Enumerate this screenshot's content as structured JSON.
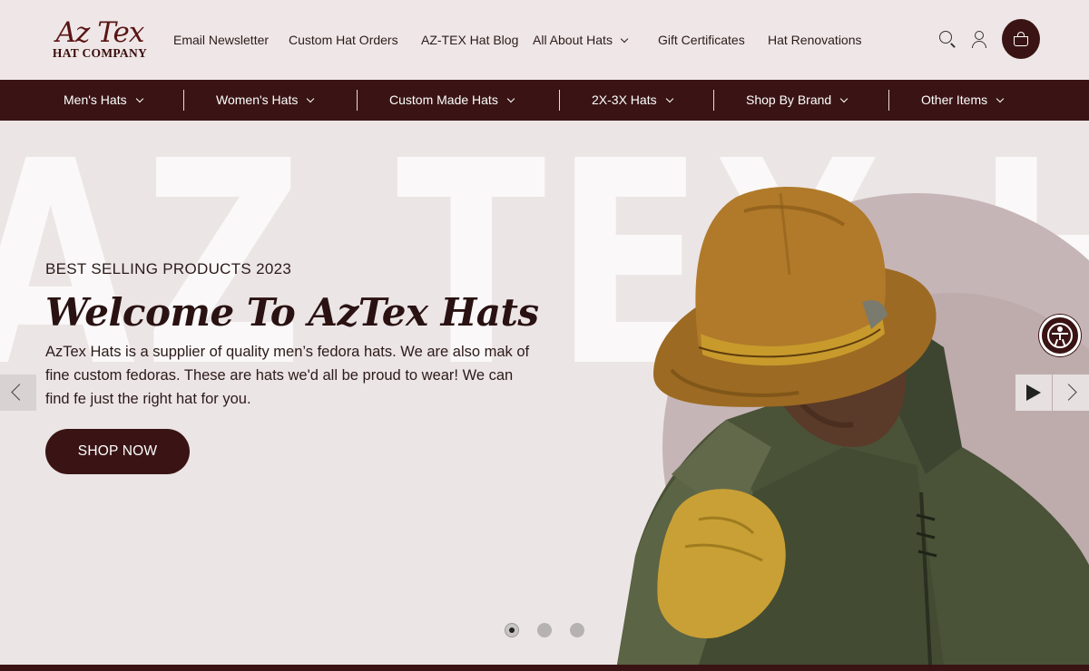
{
  "brand": {
    "logo_script": "Az Tex",
    "logo_sub": "HAT COMPANY"
  },
  "top_nav": [
    {
      "label": "Email Newsletter"
    },
    {
      "label": "Custom Hat Orders"
    },
    {
      "label": "AZ-TEX Hat Blog"
    },
    {
      "label": "All About Hats",
      "dropdown": true
    },
    {
      "label": "Gift Certificates"
    },
    {
      "label": "Hat Renovations"
    }
  ],
  "header_icons": [
    "search-icon",
    "account-icon",
    "cart-icon"
  ],
  "category_nav": [
    {
      "label": "Men's Hats"
    },
    {
      "label": "Women's Hats"
    },
    {
      "label": "Custom Made Hats"
    },
    {
      "label": "2X-3X Hats"
    },
    {
      "label": "Shop By Brand"
    },
    {
      "label": "Other Items"
    }
  ],
  "hero": {
    "background_word": "AZ TEX HAT",
    "eyebrow": "BEST SELLING PRODUCTS 2023",
    "headline": "Welcome To AzTex Hats",
    "description": "AzTex Hats is a supplier of quality men’s fedora hats. We are also mak of fine custom fedoras. These are hats we'd all be proud to wear! We can find fe just the right hat for you.",
    "cta_label": "SHOP NOW",
    "slides_total": 3,
    "slide_active": 1
  },
  "colors": {
    "brand_dark": "#3a1414",
    "page_bg": "#efe7e7"
  }
}
